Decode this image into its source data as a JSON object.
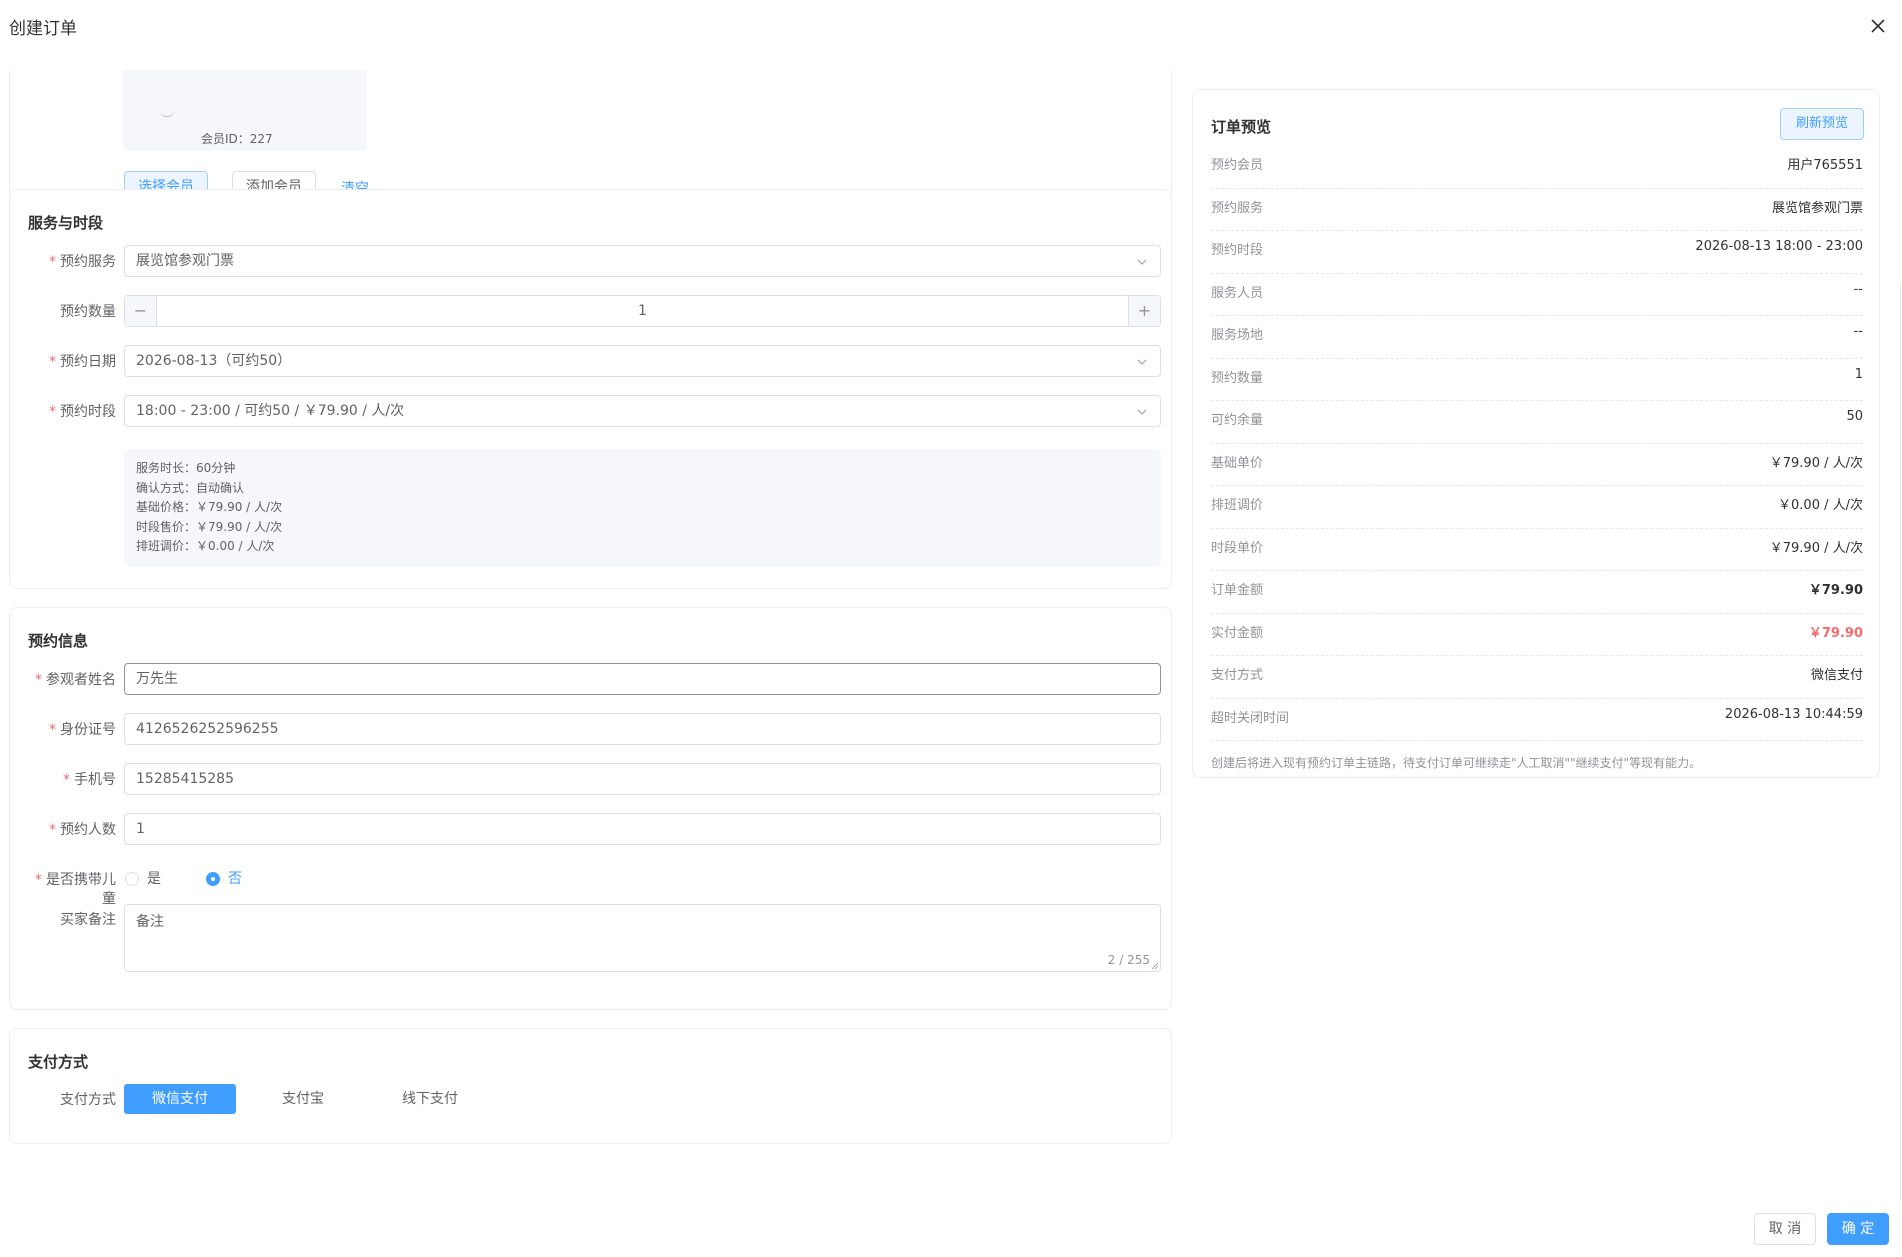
{
  "dialog": {
    "title": "创建订单"
  },
  "member": {
    "member_id_text": "会员ID：227",
    "select_label": "选择会员",
    "add_label": "添加会员",
    "clear_label": "清空"
  },
  "service_section": {
    "title": "服务与时段",
    "service_label": "预约服务",
    "service_value": "展览馆参观门票",
    "qty_label": "预约数量",
    "qty_value": "1",
    "minus": "−",
    "plus": "+",
    "date_label": "预约日期",
    "date_value": "2026-08-13（可约50）",
    "slot_label": "预约时段",
    "slot_value": "18:00 - 23:00 / 可约50 / ￥79.90 / 人/次",
    "info_lines": [
      "服务时长：60分钟",
      "确认方式：自动确认",
      "基础价格：￥79.90 / 人/次",
      "时段售价：￥79.90 / 人/次",
      "排班调价：￥0.00 / 人/次"
    ]
  },
  "booking_section": {
    "title": "预约信息",
    "name_label": "参观者姓名",
    "name_value": "万先生",
    "id_label": "身份证号",
    "id_value": "4126526252596255",
    "phone_label": "手机号",
    "phone_value": "15285415285",
    "people_label": "预约人数",
    "people_value": "1",
    "child_label_1": "是否携带儿",
    "child_label_2": "童",
    "child_yes": "是",
    "child_no": "否",
    "remark_label": "买家备注",
    "remark_value": "备注",
    "remark_counter": "2 / 255"
  },
  "payment_section": {
    "title": "支付方式",
    "label": "支付方式",
    "options": [
      "微信支付",
      "支付宝",
      "线下支付"
    ],
    "selected": "微信支付"
  },
  "preview": {
    "title": "订单预览",
    "refresh_label": "刷新预览",
    "rows": [
      {
        "k": "预约会员",
        "v": "用户765551"
      },
      {
        "k": "预约服务",
        "v": "展览馆参观门票"
      },
      {
        "k": "预约时段",
        "v": "2026-08-13 18:00 - 23:00"
      },
      {
        "k": "服务人员",
        "v": "--"
      },
      {
        "k": "服务场地",
        "v": "--"
      },
      {
        "k": "预约数量",
        "v": "1"
      },
      {
        "k": "可约余量",
        "v": "50"
      },
      {
        "k": "基础单价",
        "v": "￥79.90 / 人/次"
      },
      {
        "k": "排班调价",
        "v": "￥0.00 / 人/次"
      },
      {
        "k": "时段单价",
        "v": "￥79.90 / 人/次"
      },
      {
        "k": "订单金额",
        "v": "￥79.90"
      },
      {
        "k": "实付金额",
        "v": "￥79.90"
      },
      {
        "k": "支付方式",
        "v": "微信支付"
      },
      {
        "k": "超时关闭时间",
        "v": "2026-08-13 10:44:59"
      }
    ],
    "note": "创建后将进入现有预约订单主链路，待支付订单可继续走\"人工取消\"\"继续支付\"等现有能力。"
  },
  "footer": {
    "cancel_label": "取 消",
    "ok_label": "确 定"
  },
  "colors": {
    "primary": "#409eff",
    "danger": "#f56c6c",
    "border": "#dcdfe6"
  },
  "icons": {
    "close": "close-icon",
    "chevron": "chevron-down-icon"
  }
}
